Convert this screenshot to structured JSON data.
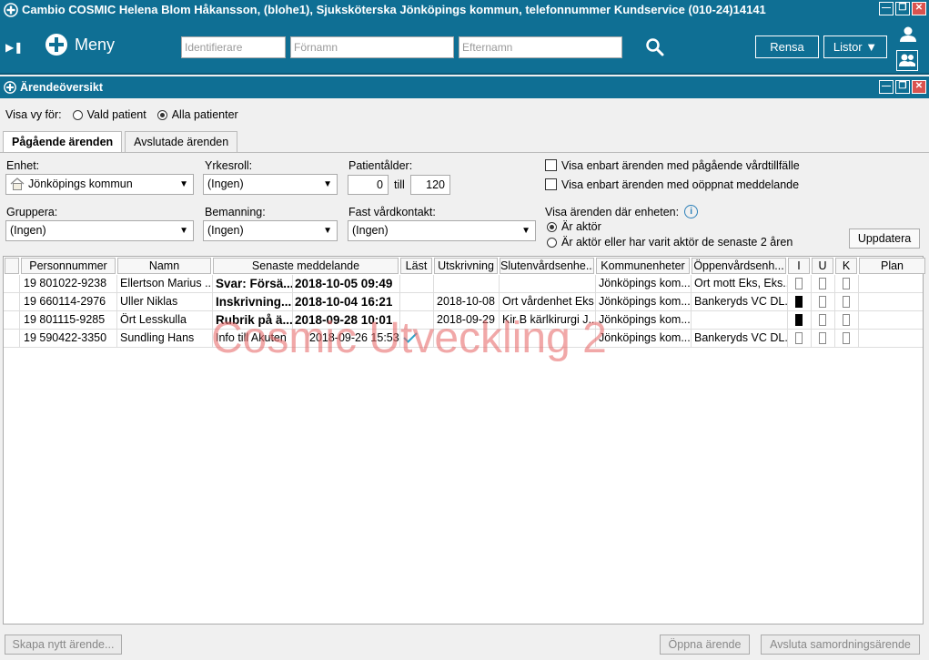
{
  "window": {
    "title": "Cambio COSMIC Helena Blom Håkansson, (blohe1), Sjuksköterska Jönköpings kommun, telefonnummer Kundservice (010-24)14141"
  },
  "toolbar": {
    "menu_label": "Meny",
    "identifier_placeholder": "Identifierare",
    "firstname_placeholder": "Förnamn",
    "lastname_placeholder": "Efternamn",
    "clear_label": "Rensa",
    "lists_label": "Listor"
  },
  "panel": {
    "title": "Ärendeöversikt",
    "view_for_label": "Visa vy för:",
    "radio_selected_patient": "Vald patient",
    "radio_all_patients": "Alla patienter",
    "tabs": [
      {
        "label": "Pågående ärenden",
        "active": true
      },
      {
        "label": "Avslutade ärenden",
        "active": false
      }
    ]
  },
  "filters": {
    "unit_label": "Enhet:",
    "unit_value": "Jönköpings kommun",
    "role_label": "Yrkesroll:",
    "role_value": "(Ingen)",
    "age_label": "Patientålder:",
    "age_from": "0",
    "age_to_label": "till",
    "age_to": "120",
    "group_label": "Gruppera:",
    "group_value": "(Ingen)",
    "staffing_label": "Bemanning:",
    "staffing_value": "(Ingen)",
    "contact_label": "Fast vårdkontakt:",
    "contact_value": "(Ingen)",
    "cb_ongoing_care": "Visa enbart ärenden med pågående vårdtillfälle",
    "cb_unopened": "Visa enbart ärenden med oöppnat meddelande",
    "show_where_label": "Visa ärenden där enheten:",
    "radio_actor": "Är aktör",
    "radio_actor_recent": "Är aktör eller har varit aktör de senaste 2 åren",
    "update_button": "Uppdatera"
  },
  "table": {
    "columns": [
      "",
      "Personnummer",
      "Namn",
      "Senaste meddelande",
      "Läst",
      "Utskrivning",
      "Slutenvårdsenhe...",
      "Kommunenheter",
      "Öppenvårdsenh...",
      "I",
      "U",
      "K",
      "Plan"
    ],
    "rows": [
      {
        "pnr": "19 801022-9238",
        "name": "Ellertson Marius ...",
        "msg": "Svar: Försä...",
        "date": "2018-10-05 09:49",
        "bold": true,
        "read": false,
        "discharge": "",
        "inpatient": "",
        "municipal": "Jönköpings kom...",
        "outpatient": "Ort mott Eks, Eks...",
        "i": false,
        "u": false,
        "k": false,
        "plan": ""
      },
      {
        "pnr": "19 660114-2976",
        "name": "Uller Niklas",
        "msg": "Inskrivning...",
        "date": "2018-10-04 16:21",
        "bold": true,
        "read": false,
        "discharge": "2018-10-08",
        "inpatient": "Ort vårdenhet Eks",
        "municipal": "Jönköpings kom...",
        "outpatient": "Bankeryds VC DL...",
        "i": true,
        "u": false,
        "k": false,
        "plan": ""
      },
      {
        "pnr": "19 801115-9285",
        "name": "Ört Lesskulla",
        "msg": "Rubrik på ä...",
        "date": "2018-09-28 10:01",
        "bold": true,
        "read": false,
        "discharge": "2018-09-29",
        "inpatient": "Kir B kärlkirurgi J...",
        "municipal": "Jönköpings kom...",
        "outpatient": "",
        "i": true,
        "u": false,
        "k": false,
        "plan": ""
      },
      {
        "pnr": "19 590422-3350",
        "name": "Sundling Hans",
        "msg": "Info till Akuten",
        "date": "2018-09-26 15:53",
        "bold": false,
        "read": true,
        "discharge": "",
        "inpatient": "",
        "municipal": "Jönköpings kom...",
        "outpatient": "Bankeryds VC DL...",
        "i": false,
        "u": false,
        "k": false,
        "plan": ""
      }
    ]
  },
  "watermark": "Cosmic Utveckling 2",
  "footer": {
    "create_case": "Skapa nytt ärende...",
    "open_case": "Öppna ärende",
    "close_coordination": "Avsluta samordningsärende"
  },
  "colors": {
    "header_blue": "#0f6f94",
    "watermark": "#e86e6e",
    "check": "#2ba3c9"
  }
}
